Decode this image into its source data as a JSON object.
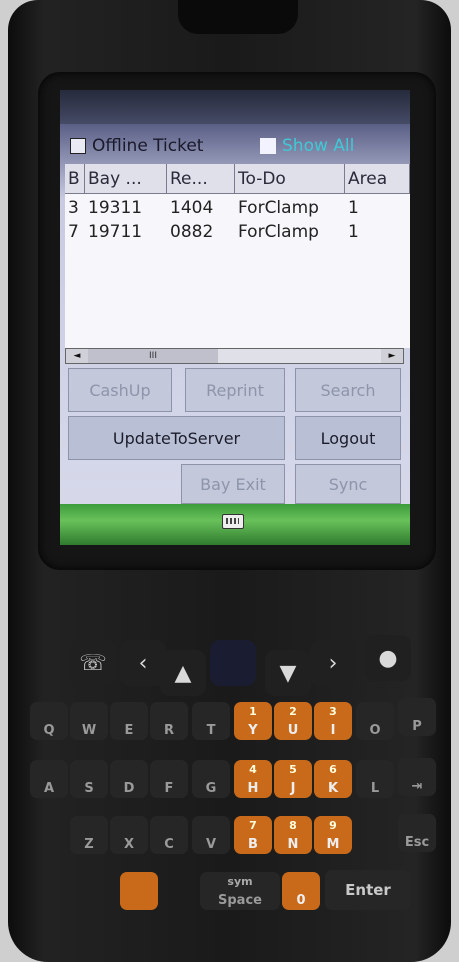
{
  "app": {
    "checkbox_offline": "Offline Ticket",
    "checkbox_showall": "Show All"
  },
  "grid": {
    "columns": [
      "B",
      "Bay ...",
      "Re...",
      "To-Do",
      "Area"
    ],
    "rows": [
      [
        "3",
        "19311",
        "1404",
        "ForClamp",
        "1"
      ],
      [
        "7",
        "19711",
        "0882",
        "ForClamp",
        "1"
      ]
    ]
  },
  "scroll": {
    "left": "◄",
    "thumb": "III",
    "right": "►"
  },
  "buttons": {
    "cashup": "CashUp",
    "reprint": "Reprint",
    "search": "Search",
    "update": "UpdateToServer",
    "logout": "Logout",
    "bayexit": "Bay Exit",
    "sync": "Sync"
  },
  "keypad": {
    "row1": [
      "Q",
      "W",
      "E",
      "R",
      "T",
      "Y",
      "U",
      "I",
      "O",
      "P"
    ],
    "row2": [
      "A",
      "S",
      "D",
      "F",
      "G",
      "H",
      "J",
      "K",
      "L"
    ],
    "row3": [
      "Z",
      "X",
      "C",
      "V",
      "B",
      "N",
      "M"
    ],
    "nums": [
      "1",
      "2",
      "3",
      "4",
      "5",
      "6",
      "7",
      "8",
      "9",
      "0"
    ],
    "space": "Space",
    "sym": "sym",
    "enter": "Enter",
    "esc": "Esc"
  }
}
